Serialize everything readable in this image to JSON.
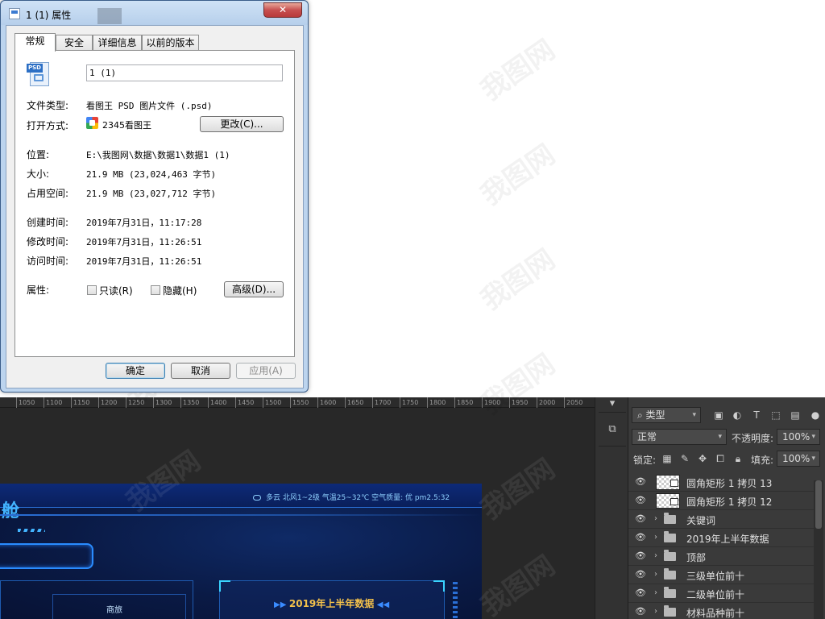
{
  "dialog": {
    "title": "1 (1) 属性",
    "close_label": "✕",
    "tabs": [
      {
        "label": "常规"
      },
      {
        "label": "安全"
      },
      {
        "label": "详细信息"
      },
      {
        "label": "以前的版本"
      }
    ],
    "file_name": "1 (1)",
    "file_icon_tag": "PSD",
    "file_type_label": "文件类型:",
    "file_type_value": "看图王 PSD 图片文件 (.psd)",
    "open_with_label": "打开方式:",
    "open_with_value": "2345看图王",
    "change_button": "更改(C)...",
    "location_label": "位置:",
    "location_value": "E:\\我图网\\数据\\数据1\\数据1 (1)",
    "size_label": "大小:",
    "size_value": "21.9 MB (23,024,463 字节)",
    "disk_size_label": "占用空间:",
    "disk_size_value": "21.9 MB (23,027,712 字节)",
    "created_label": "创建时间:",
    "created_value": "2019年7月31日，11:17:28",
    "modified_label": "修改时间:",
    "modified_value": "2019年7月31日，11:26:51",
    "accessed_label": "访问时间:",
    "accessed_value": "2019年7月31日，11:26:51",
    "attributes_label": "属性:",
    "readonly_label": "只读(R)",
    "readonly_checked": false,
    "hidden_label": "隐藏(H)",
    "hidden_checked": false,
    "advanced_button": "高级(D)...",
    "ok_button": "确定",
    "cancel_button": "取消",
    "apply_button": "应用(A)"
  },
  "photoshop": {
    "ruler_ticks": [
      "1050",
      "1100",
      "1150",
      "1200",
      "1250",
      "1300",
      "1350",
      "1400",
      "1450",
      "1500",
      "1550",
      "1600",
      "1650",
      "1700",
      "1750",
      "1800",
      "1850",
      "1900",
      "1950",
      "2000",
      "2050"
    ],
    "document": {
      "title_fragment": "舱",
      "weather": "多云  北风1~2级  气温25~32℃   空气质量: 优   pm2.5:32",
      "cell_label": "商旅",
      "panel_title": "2019年上半年数据"
    },
    "layers_panel": {
      "filter_kind": "类型",
      "blend_mode": "正常",
      "opacity_label": "不透明度:",
      "opacity_value": "100%",
      "lock_label": "锁定:",
      "fill_label": "填充:",
      "fill_value": "100%",
      "layers": [
        {
          "name": "圆角矩形 1 拷贝 13",
          "kind": "shape"
        },
        {
          "name": "圆角矩形 1 拷贝 12",
          "kind": "shape"
        },
        {
          "name": "关键词",
          "kind": "group"
        },
        {
          "name": "2019年上半年数据",
          "kind": "group"
        },
        {
          "name": "顶部",
          "kind": "group"
        },
        {
          "name": "三级单位前十",
          "kind": "group"
        },
        {
          "name": "二级单位前十",
          "kind": "group"
        },
        {
          "name": "材料品种前十",
          "kind": "group"
        }
      ]
    }
  }
}
